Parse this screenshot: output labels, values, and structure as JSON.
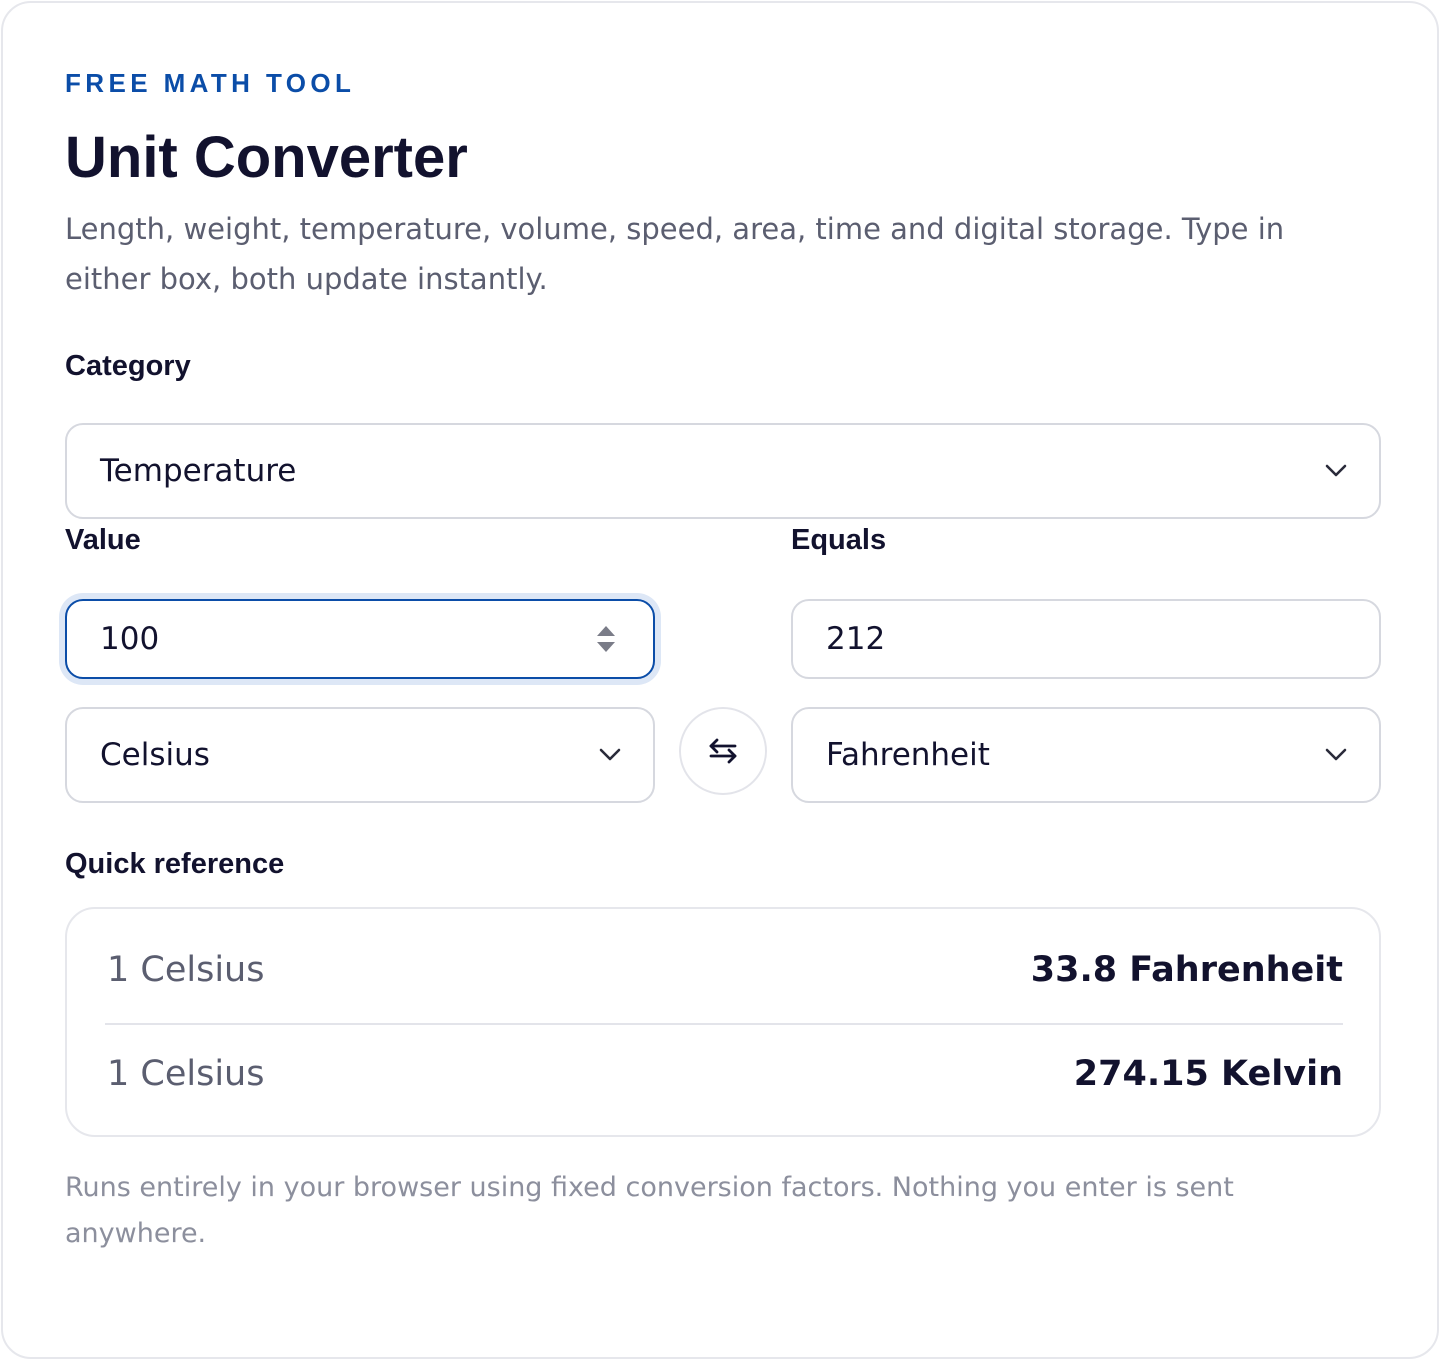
{
  "header": {
    "eyebrow": "FREE MATH TOOL",
    "title": "Unit Converter",
    "subtitle": "Length, weight, temperature, volume, speed, area, time and digital storage. Type in either box, both update instantly."
  },
  "category": {
    "label": "Category",
    "selected": "Temperature"
  },
  "from": {
    "label": "Value",
    "value": "100",
    "unit": "Celsius"
  },
  "to": {
    "label": "Equals",
    "value": "212",
    "unit": "Fahrenheit"
  },
  "swap": {
    "icon": "swap-arrows-icon"
  },
  "reference": {
    "label": "Quick reference",
    "rows": [
      {
        "from": "1 Celsius",
        "to": "33.8 Fahrenheit"
      },
      {
        "from": "1 Celsius",
        "to": "274.15 Kelvin"
      }
    ]
  },
  "footnote": "Runs entirely in your browser using fixed conversion factors. Nothing you enter is sent anywhere.",
  "colors": {
    "accent": "#0b4da8",
    "text": "#12122e",
    "muted": "#5b5e70",
    "border": "#d6d8df"
  }
}
